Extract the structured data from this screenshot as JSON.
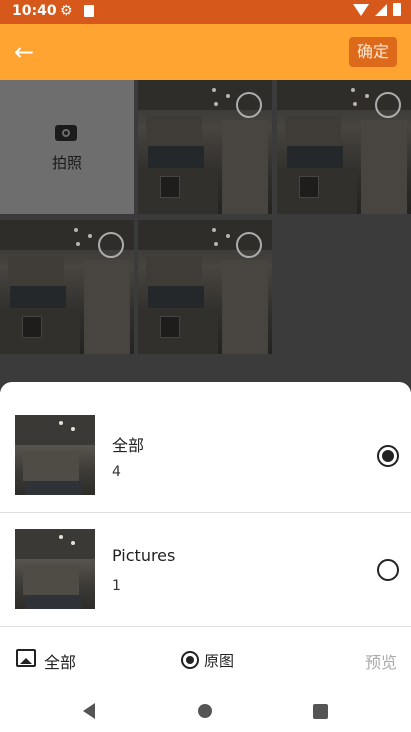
{
  "status": {
    "time": "10:40"
  },
  "header": {
    "back_label": "back",
    "confirm_label": "确定"
  },
  "grid": {
    "camera_label": "拍照",
    "items": [
      {
        "type": "photo",
        "selected": false
      },
      {
        "type": "photo",
        "selected": false
      },
      {
        "type": "photo",
        "selected": false
      },
      {
        "type": "photo",
        "selected": false
      }
    ]
  },
  "folders": [
    {
      "name": "全部",
      "count": "4",
      "selected": true
    },
    {
      "name": "Pictures",
      "count": "1",
      "selected": false
    }
  ],
  "bottom_bar": {
    "all_label": "全部",
    "original_label": "原图",
    "preview_label": "预览"
  },
  "colors": {
    "app_bar": "#ffa431",
    "status_bar": "#d6591b",
    "confirm_button": "#dd6a1a"
  }
}
